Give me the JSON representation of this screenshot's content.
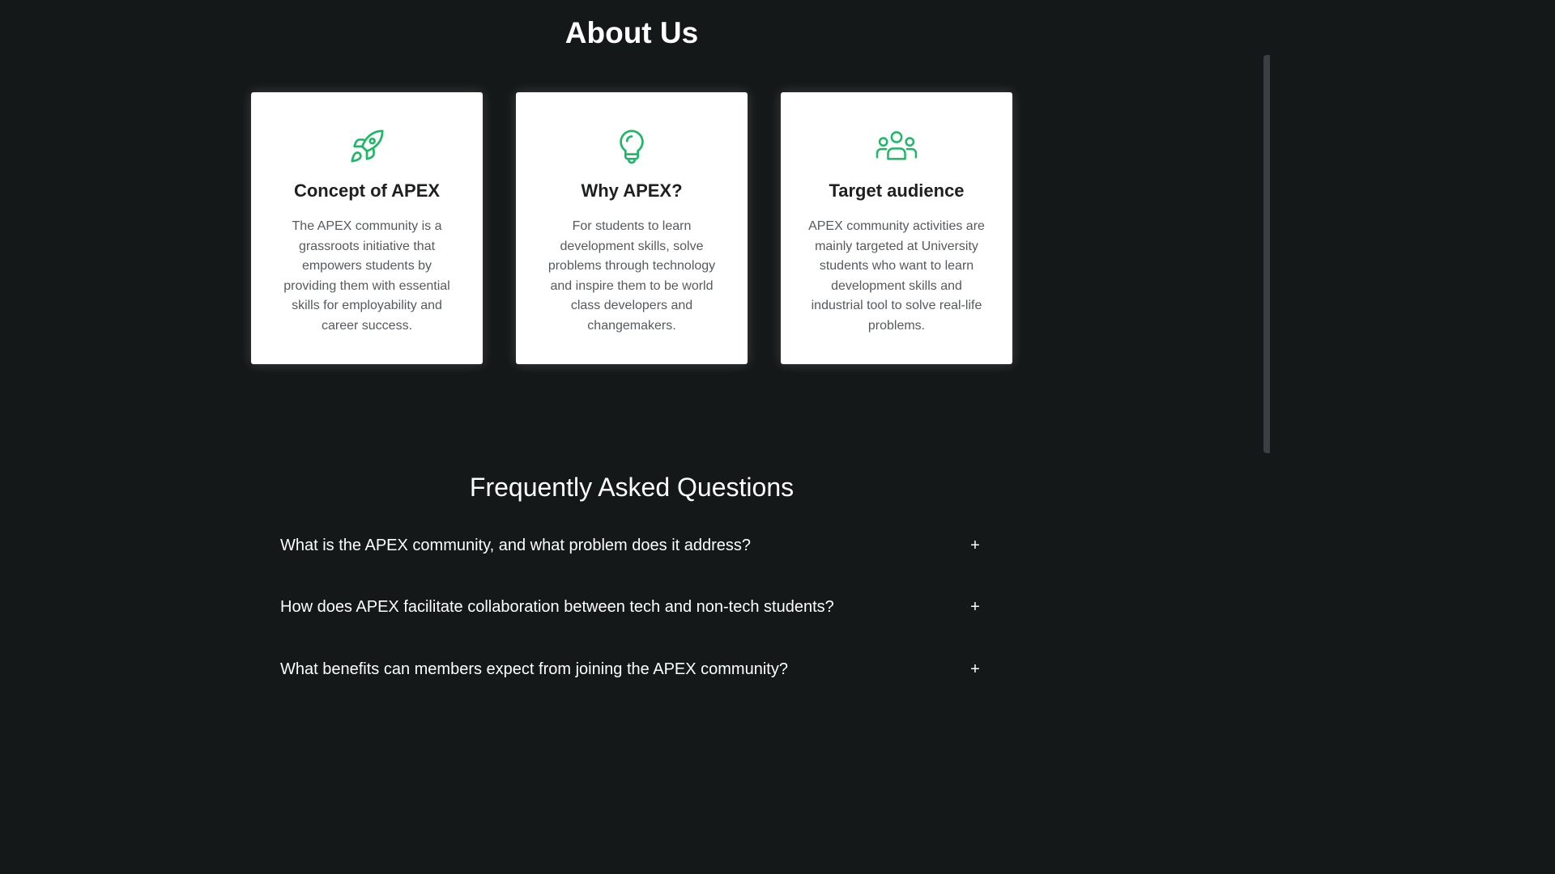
{
  "about": {
    "title": "About Us",
    "cards": [
      {
        "icon": "rocket-icon",
        "title": "Concept of APEX",
        "text": "The APEX community is a grassroots initiative that empowers students by providing them with essential skills for employability and career success."
      },
      {
        "icon": "lightbulb-icon",
        "title": "Why APEX?",
        "text": "For students to learn development skills, solve problems through technology and inspire them to be world class developers and changemakers."
      },
      {
        "icon": "users-icon",
        "title": "Target audience",
        "text": "APEX community activities are mainly targeted at University students who want to learn development skills and industrial tool to solve real-life problems."
      }
    ]
  },
  "faq": {
    "title": "Frequently Asked Questions",
    "items": [
      {
        "question": "What is the APEX community, and what problem does it address?",
        "toggle": "+"
      },
      {
        "question": "How does APEX facilitate collaboration between tech and non-tech students?",
        "toggle": "+"
      },
      {
        "question": "What benefits can members expect from joining the APEX community?",
        "toggle": "+"
      }
    ]
  },
  "colors": {
    "background": "#151819",
    "accent": "#1db865",
    "card": "#ffffff"
  }
}
